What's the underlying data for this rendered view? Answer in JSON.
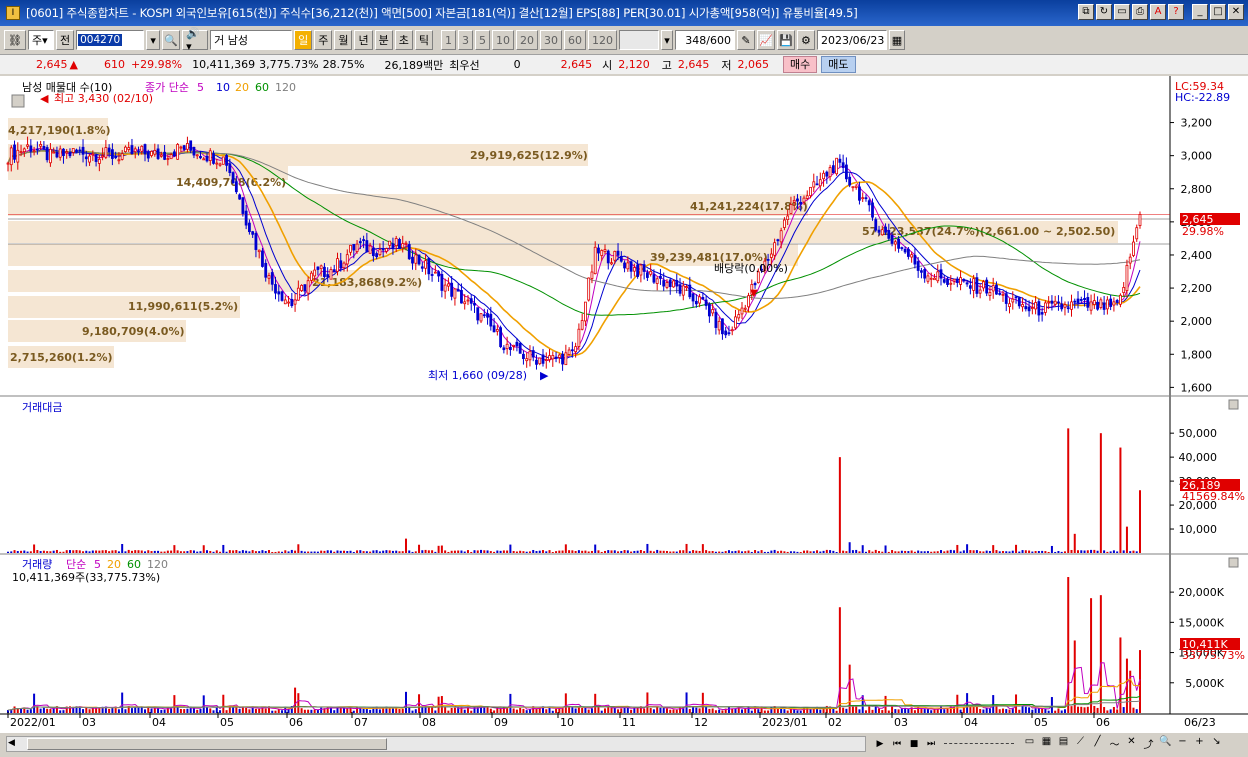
{
  "window": {
    "title": "[0601] 주식종합차트 - KOSPI 외국인보유[615(천)] 주식수[36,212(천)] 액면[500] 자본금[181(억)] 결산[12월] EPS[88] PER[30.01] 시가총액[958(억)] 유통비율[49.5]"
  },
  "toolbar": {
    "market": "주",
    "prev_label": "전",
    "stock_code": "004270",
    "stock_name": "거 남성",
    "periods": [
      "일",
      "주",
      "월",
      "년",
      "분",
      "초",
      "틱"
    ],
    "nums": [
      "1",
      "3",
      "5",
      "10",
      "20",
      "30",
      "60",
      "120"
    ],
    "count": "348",
    "count_max": "/600",
    "date": "2023/06/23"
  },
  "quote": {
    "price": "2,645",
    "arrow": "▲",
    "change": "610",
    "change_rate": "+29.98%",
    "volume": "10,411,369",
    "volume_rate": "3,775.73%",
    "turnover": "28.75%",
    "amount": "26,189백만",
    "best_label": "최우선",
    "best_value": "0",
    "ask": "2,645",
    "open_label": "시",
    "open": "2,120",
    "high_label": "고",
    "high": "2,645",
    "low_label": "저",
    "low": "2,065",
    "buy_label": "매수",
    "sell_label": "매도"
  },
  "price_panel": {
    "title": "남성 매물대 수(10)",
    "ma_label": "종가 단순",
    "ma_periods": [
      "5",
      "10",
      "20",
      "60",
      "120"
    ],
    "ma_colors": [
      "#c000c0",
      "#0000d0",
      "#f0a000",
      "#009000",
      "#808080"
    ],
    "lc": "LC:59.34",
    "hc": "HC:-22.89",
    "high_note": "최고 3,430 (02/10)",
    "low_note": "최저 1,660 (09/28)",
    "div_note": "배당락(0.00%)",
    "last_price": "2,645",
    "last_rate": "29.98%",
    "y_ticks": [
      "3,200",
      "3,000",
      "2,800",
      "2,600",
      "2,400",
      "2,200",
      "2,000",
      "1,800",
      "1,600"
    ],
    "volume_profile": [
      {
        "label": "4,217,190(1.8%)"
      },
      {
        "label": "14,409,708(6.2%)"
      },
      {
        "label": "29,919,625(12.9%)"
      },
      {
        "label": "41,241,224(17.8%)"
      },
      {
        "label": "57,123,537(24.7%)(2,661.00 ~ 2,502.50)"
      },
      {
        "label": "39,239,481(17.0%)"
      },
      {
        "label": "21,183,868(9.2%)"
      },
      {
        "label": "11,990,611(5.2%)"
      },
      {
        "label": "9,180,709(4.0%)"
      },
      {
        "label": "2,715,260(1.2%)"
      }
    ]
  },
  "amount_panel": {
    "title": "거래대금",
    "y_ticks": [
      "50,000",
      "40,000",
      "30,000",
      "20,000",
      "10,000"
    ],
    "last_value": "26,189",
    "last_avg": "41569.84%"
  },
  "volume_panel": {
    "title": "거래량",
    "ma_label": "단순",
    "ma_periods": [
      "5",
      "20",
      "60",
      "120"
    ],
    "ma_colors": [
      "#c000c0",
      "#f0a000",
      "#009000",
      "#808080"
    ],
    "summary": "10,411,369주(33,775.73%)",
    "y_ticks": [
      "20,000K",
      "15,000K",
      "10,000K",
      "5,000K"
    ],
    "last_value": "10,411K",
    "last_rate": "33775.73%"
  },
  "x_axis": [
    "2022/01",
    "03",
    "04",
    "05",
    "06",
    "07",
    "08",
    "09",
    "10",
    "11",
    "12",
    "2023/01",
    "02",
    "03",
    "04",
    "05",
    "06",
    "06/23"
  ],
  "chart_data": {
    "type": "line",
    "x_ticks": [
      "2022/01",
      "03",
      "04",
      "05",
      "06",
      "07",
      "08",
      "09",
      "10",
      "11",
      "12",
      "2023/01",
      "02",
      "03",
      "04",
      "05",
      "06"
    ],
    "close": [
      3000,
      3060,
      2990,
      3020,
      3010,
      3000,
      3020,
      3000,
      3050,
      3010,
      2980,
      2600,
      2250,
      2100,
      2280,
      2320,
      2460,
      2430,
      2460,
      2350,
      2220,
      2120,
      1990,
      1830,
      1780,
      1770,
      1800,
      2420,
      2380,
      2300,
      2250,
      2180,
      2100,
      1900,
      2150,
      2400,
      2700,
      2800,
      2950,
      2800,
      2560,
      2450,
      2300,
      2250,
      2220,
      2200,
      2120,
      2070,
      2080,
      2100,
      2090,
      2080,
      2645
    ],
    "ylim": [
      1560,
      3300
    ],
    "events": {
      "high": {
        "value": 3430,
        "date": "02/10"
      },
      "low": {
        "value": 1660,
        "date": "09/28"
      }
    }
  }
}
